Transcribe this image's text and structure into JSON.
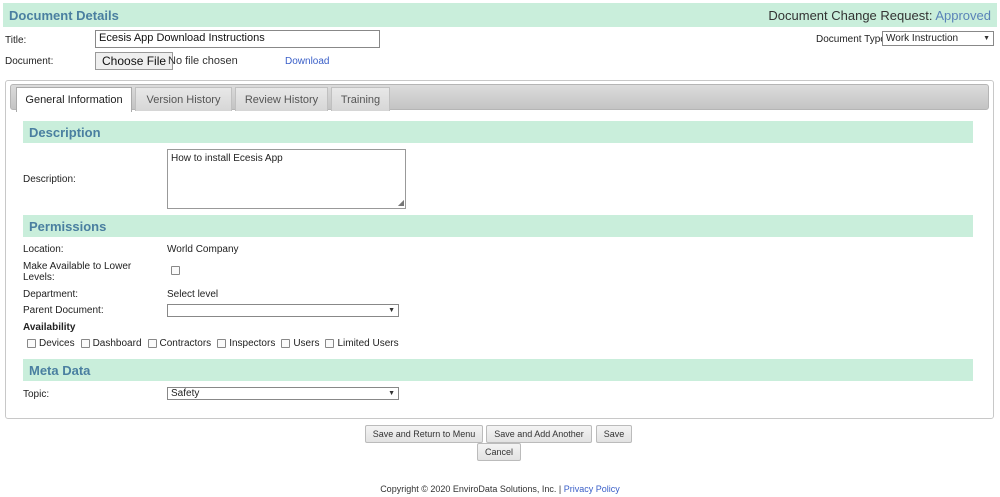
{
  "header": {
    "title": "Document Details",
    "dcr_label": "Document Change Request:",
    "dcr_status": "Approved"
  },
  "form": {
    "title_label": "Title:",
    "title_value": "Ecesis App Download Instructions",
    "document_label": "Document:",
    "choose_file_label": "Choose File",
    "no_file_text": "No file chosen",
    "download_link": "Download",
    "doc_type_label": "Document Type:",
    "doc_type_value": "Work Instruction"
  },
  "tabs": [
    {
      "label": "General Information",
      "active": true
    },
    {
      "label": "Version History",
      "active": false
    },
    {
      "label": "Review History",
      "active": false
    },
    {
      "label": "Training",
      "active": false
    }
  ],
  "description": {
    "section_title": "Description",
    "label": "Description:",
    "value": "How to install Ecesis App"
  },
  "permissions": {
    "section_title": "Permissions",
    "location_label": "Location:",
    "location_value": "World Company",
    "lower_levels_label": "Make Available to Lower Levels:",
    "department_label": "Department:",
    "department_value": "Select level",
    "parent_label": "Parent Document:",
    "parent_value": "",
    "availability_label": "Availability",
    "availability_options": [
      "Devices",
      "Dashboard",
      "Contractors",
      "Inspectors",
      "Users",
      "Limited Users"
    ]
  },
  "meta": {
    "section_title": "Meta Data",
    "topic_label": "Topic:",
    "topic_value": "Safety"
  },
  "buttons": {
    "save_return": "Save and Return to Menu",
    "save_add": "Save and Add Another",
    "save": "Save",
    "cancel": "Cancel"
  },
  "footer": {
    "copyright": "Copyright © 2020 EnviroData Solutions, Inc. |",
    "privacy": "Privacy Policy"
  },
  "colors": {
    "section_bg": "#c9eedb",
    "section_text": "#4a7fa0",
    "link": "#3a5fc8"
  }
}
